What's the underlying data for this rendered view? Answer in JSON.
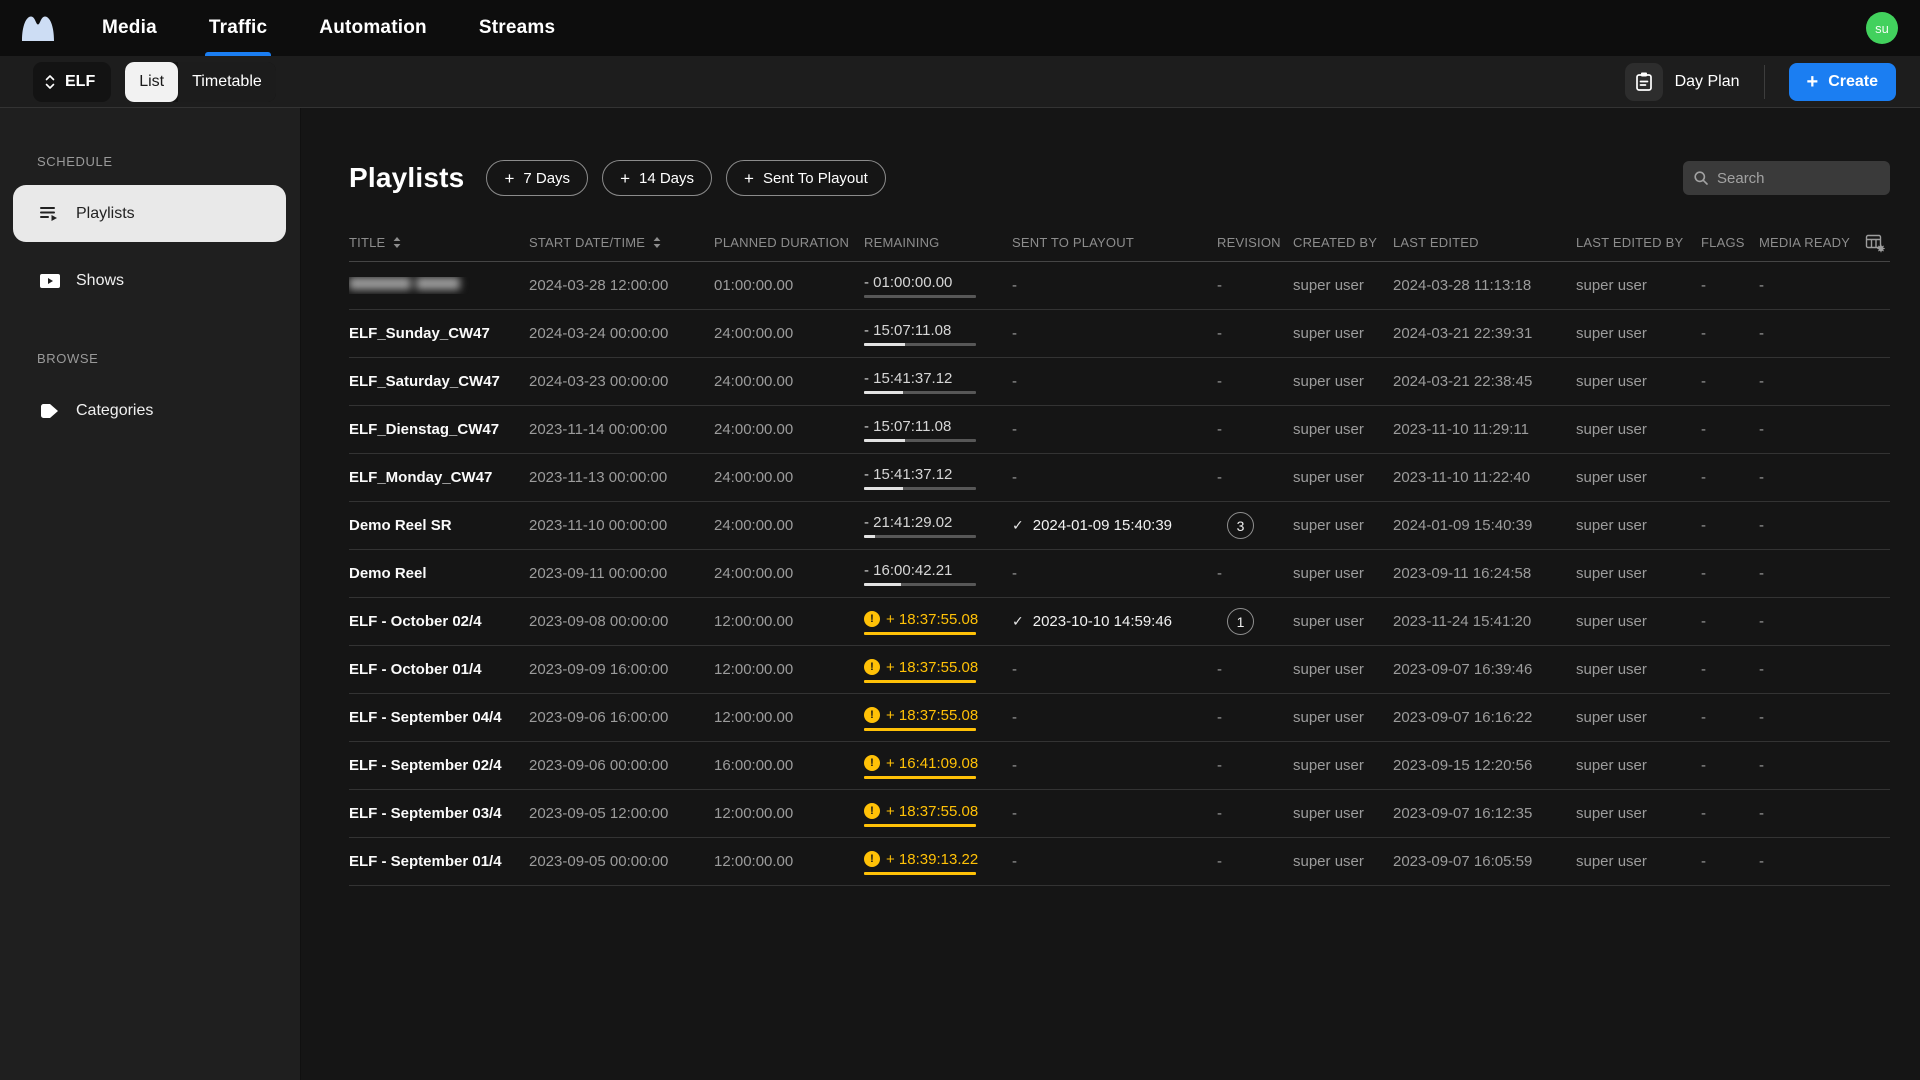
{
  "colors": {
    "accent": "#1b7ef2",
    "warning": "#FFC107",
    "avatar_green": "#42d15d"
  },
  "icons": {
    "logo": "mountain-logo",
    "channel_selector": "chevron-up-down",
    "day_plan": "calendar-clipboard",
    "create": "plus",
    "search": "magnifier",
    "sort": "up-down-triangles",
    "sent": "checkmark",
    "remaining_warning": "exclamation-circle",
    "column_settings": "table-gear",
    "playlists": "playlist-lines-play",
    "shows": "screen-play",
    "categories": "tag"
  },
  "nav": {
    "items": [
      {
        "label": "Media",
        "active": false
      },
      {
        "label": "Traffic",
        "active": true
      },
      {
        "label": "Automation",
        "active": false
      },
      {
        "label": "Streams",
        "active": false
      }
    ],
    "avatar": "su"
  },
  "toolbar": {
    "channel": "ELF",
    "views": [
      {
        "label": "List",
        "active": true
      },
      {
        "label": "Timetable",
        "active": false
      }
    ],
    "day_plan_label": "Day Plan",
    "create_label": "Create"
  },
  "sidebar": {
    "sections": [
      {
        "label": "SCHEDULE",
        "items": [
          {
            "label": "Playlists",
            "icon": "playlist-lines-play",
            "active": true
          },
          {
            "label": "Shows",
            "icon": "screen-play",
            "active": false
          }
        ]
      },
      {
        "label": "BROWSE",
        "items": [
          {
            "label": "Categories",
            "icon": "tag",
            "active": false
          }
        ]
      }
    ]
  },
  "main": {
    "title": "Playlists",
    "filters": [
      {
        "label": "7 Days"
      },
      {
        "label": "14 Days"
      },
      {
        "label": "Sent To Playout"
      }
    ],
    "search_placeholder": "Search",
    "table": {
      "columns": [
        "TITLE",
        "START DATE/TIME",
        "PLANNED DURATION",
        "REMAINING",
        "SENT TO PLAYOUT",
        "REVISION",
        "CREATED BY",
        "LAST EDITED",
        "LAST EDITED BY",
        "FLAGS",
        "MEDIA READY"
      ],
      "sortable_columns": [
        "TITLE",
        "START DATE/TIME"
      ],
      "check_glyph": "✓",
      "dash": "-",
      "rows": [
        {
          "title": "",
          "redacted": true,
          "start": "2024-03-28 12:00:00",
          "planned": "01:00:00.00",
          "remaining_sign": "-",
          "remaining": "01:00:00.00",
          "warning": false,
          "progress": 0,
          "sent": null,
          "revision": null,
          "created_by": "super user",
          "last_edited": "2024-03-28 11:13:18",
          "last_edited_by": "super user",
          "flags": "-",
          "media_ready": "-"
        },
        {
          "title": "ELF_Sunday_CW47",
          "redacted": false,
          "start": "2024-03-24 00:00:00",
          "planned": "24:00:00.00",
          "remaining_sign": "-",
          "remaining": "15:07:11.08",
          "warning": false,
          "progress": 0.37,
          "sent": null,
          "revision": null,
          "created_by": "super user",
          "last_edited": "2024-03-21 22:39:31",
          "last_edited_by": "super user",
          "flags": "-",
          "media_ready": "-"
        },
        {
          "title": "ELF_Saturday_CW47",
          "redacted": false,
          "start": "2024-03-23 00:00:00",
          "planned": "24:00:00.00",
          "remaining_sign": "-",
          "remaining": "15:41:37.12",
          "warning": false,
          "progress": 0.35,
          "sent": null,
          "revision": null,
          "created_by": "super user",
          "last_edited": "2024-03-21 22:38:45",
          "last_edited_by": "super user",
          "flags": "-",
          "media_ready": "-"
        },
        {
          "title": "ELF_Dienstag_CW47",
          "redacted": false,
          "start": "2023-11-14 00:00:00",
          "planned": "24:00:00.00",
          "remaining_sign": "-",
          "remaining": "15:07:11.08",
          "warning": false,
          "progress": 0.37,
          "sent": null,
          "revision": null,
          "created_by": "super user",
          "last_edited": "2023-11-10 11:29:11",
          "last_edited_by": "super user",
          "flags": "-",
          "media_ready": "-"
        },
        {
          "title": "ELF_Monday_CW47",
          "redacted": false,
          "start": "2023-11-13 00:00:00",
          "planned": "24:00:00.00",
          "remaining_sign": "-",
          "remaining": "15:41:37.12",
          "warning": false,
          "progress": 0.35,
          "sent": null,
          "revision": null,
          "created_by": "super user",
          "last_edited": "2023-11-10 11:22:40",
          "last_edited_by": "super user",
          "flags": "-",
          "media_ready": "-"
        },
        {
          "title": "Demo Reel SR",
          "redacted": false,
          "start": "2023-11-10 00:00:00",
          "planned": "24:00:00.00",
          "remaining_sign": "-",
          "remaining": "21:41:29.02",
          "warning": false,
          "progress": 0.1,
          "sent": "2024-01-09 15:40:39",
          "revision": "3",
          "created_by": "super user",
          "last_edited": "2024-01-09 15:40:39",
          "last_edited_by": "super user",
          "flags": "-",
          "media_ready": "-"
        },
        {
          "title": "Demo Reel",
          "redacted": false,
          "start": "2023-09-11 00:00:00",
          "planned": "24:00:00.00",
          "remaining_sign": "-",
          "remaining": "16:00:42.21",
          "warning": false,
          "progress": 0.33,
          "sent": null,
          "revision": null,
          "created_by": "super user",
          "last_edited": "2023-09-11 16:24:58",
          "last_edited_by": "super user",
          "flags": "-",
          "media_ready": "-"
        },
        {
          "title": "ELF - October 02/4",
          "redacted": false,
          "start": "2023-09-08 00:00:00",
          "planned": "12:00:00.00",
          "remaining_sign": "+",
          "remaining": "18:37:55.08",
          "warning": true,
          "progress": 1,
          "sent": "2023-10-10 14:59:46",
          "revision": "1",
          "created_by": "super user",
          "last_edited": "2023-11-24 15:41:20",
          "last_edited_by": "super user",
          "flags": "-",
          "media_ready": "-"
        },
        {
          "title": "ELF - October 01/4",
          "redacted": false,
          "start": "2023-09-09 16:00:00",
          "planned": "12:00:00.00",
          "remaining_sign": "+",
          "remaining": "18:37:55.08",
          "warning": true,
          "progress": 1,
          "sent": null,
          "revision": null,
          "created_by": "super user",
          "last_edited": "2023-09-07 16:39:46",
          "last_edited_by": "super user",
          "flags": "-",
          "media_ready": "-"
        },
        {
          "title": "ELF - September 04/4",
          "redacted": false,
          "start": "2023-09-06 16:00:00",
          "planned": "12:00:00.00",
          "remaining_sign": "+",
          "remaining": "18:37:55.08",
          "warning": true,
          "progress": 1,
          "sent": null,
          "revision": null,
          "created_by": "super user",
          "last_edited": "2023-09-07 16:16:22",
          "last_edited_by": "super user",
          "flags": "-",
          "media_ready": "-"
        },
        {
          "title": "ELF - September 02/4",
          "redacted": false,
          "start": "2023-09-06 00:00:00",
          "planned": "16:00:00.00",
          "remaining_sign": "+",
          "remaining": "16:41:09.08",
          "warning": true,
          "progress": 1,
          "sent": null,
          "revision": null,
          "created_by": "super user",
          "last_edited": "2023-09-15 12:20:56",
          "last_edited_by": "super user",
          "flags": "-",
          "media_ready": "-"
        },
        {
          "title": "ELF - September 03/4",
          "redacted": false,
          "start": "2023-09-05 12:00:00",
          "planned": "12:00:00.00",
          "remaining_sign": "+",
          "remaining": "18:37:55.08",
          "warning": true,
          "progress": 1,
          "sent": null,
          "revision": null,
          "created_by": "super user",
          "last_edited": "2023-09-07 16:12:35",
          "last_edited_by": "super user",
          "flags": "-",
          "media_ready": "-"
        },
        {
          "title": "ELF - September 01/4",
          "redacted": false,
          "start": "2023-09-05 00:00:00",
          "planned": "12:00:00.00",
          "remaining_sign": "+",
          "remaining": "18:39:13.22",
          "warning": true,
          "progress": 1,
          "sent": null,
          "revision": null,
          "created_by": "super user",
          "last_edited": "2023-09-07 16:05:59",
          "last_edited_by": "super user",
          "flags": "-",
          "media_ready": "-"
        }
      ]
    }
  }
}
